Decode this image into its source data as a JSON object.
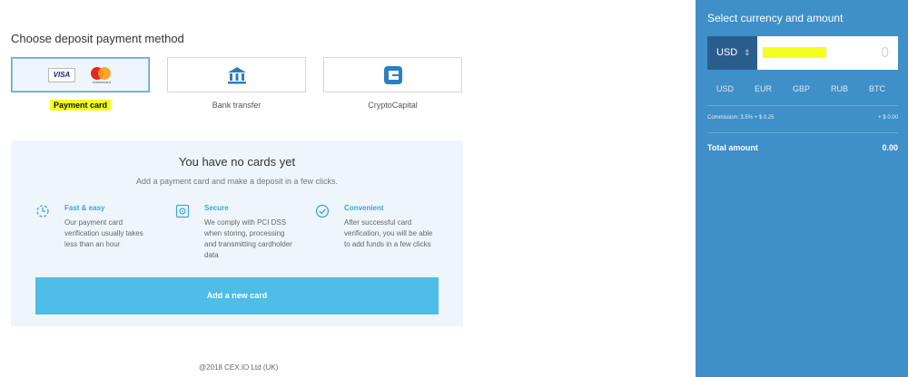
{
  "main": {
    "heading": "Choose deposit payment method",
    "methods": [
      {
        "label": "Payment card",
        "icon": "payment-card-icons",
        "selected": true
      },
      {
        "label": "Bank transfer",
        "icon": "bank-icon",
        "selected": false
      },
      {
        "label": "CryptoCapital",
        "icon": "cryptocapital-icon",
        "selected": false
      }
    ],
    "visa_text": "VISA",
    "mastercard_text": "mastercard",
    "panel": {
      "title": "You have no cards yet",
      "subtitle": "Add a payment card and make a deposit in a few clicks.",
      "features": [
        {
          "title": "Fast & easy",
          "desc": "Our payment card verification usually takes less than an hour",
          "icon": "clock-icon"
        },
        {
          "title": "Secure",
          "desc": "We comply with PCI DSS when storing, processing and transmitting cardholder data",
          "icon": "safe-icon"
        },
        {
          "title": "Convenient",
          "desc": "After successful card verification, you will be able to add funds in a few clicks",
          "icon": "check-circle-icon"
        }
      ],
      "button": "Add a new card"
    },
    "footer": "@2018 CEX.IO Ltd (UK)"
  },
  "sidebar": {
    "title": "Select currency and amount",
    "selected_currency": "USD",
    "amount_value": "0",
    "currencies": [
      "USD",
      "EUR",
      "GBP",
      "RUB",
      "BTC"
    ],
    "commission_label": "Commission: 3.5% + $ 0.25",
    "commission_value": "+ $ 0.00",
    "total_label": "Total amount",
    "total_value": "0.00"
  },
  "colors": {
    "sidebar_bg": "#3f8fc8",
    "button_bg": "#4ebde7",
    "accent": "#3aa6dc",
    "highlight": "#f4ff1f"
  }
}
